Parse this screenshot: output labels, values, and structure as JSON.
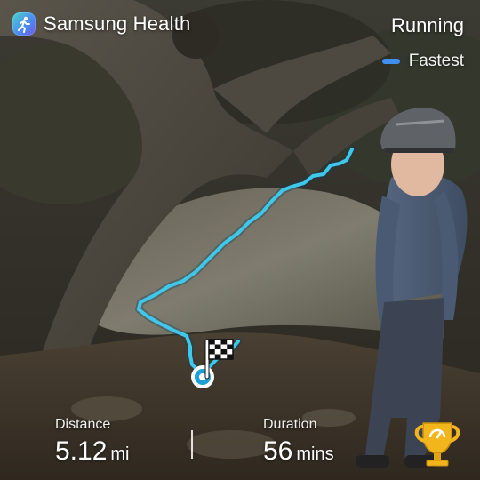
{
  "header": {
    "app_name": "Samsung Health",
    "activity_type": "Running",
    "legend_label": "Fastest"
  },
  "stats": {
    "distance": {
      "label": "Distance",
      "value": "5.12",
      "unit": "mi"
    },
    "duration": {
      "label": "Duration",
      "value": "56",
      "unit": "mins"
    }
  },
  "icons": {
    "app_logo": "samsung-health-logo-icon",
    "finish": "checkered-flag-icon",
    "start": "start-point-icon",
    "achievement": "trophy-icon"
  },
  "colors": {
    "route": "#40c8ea",
    "legend_swatch": "#3f8ff0",
    "trophy": "#f2b51c"
  }
}
